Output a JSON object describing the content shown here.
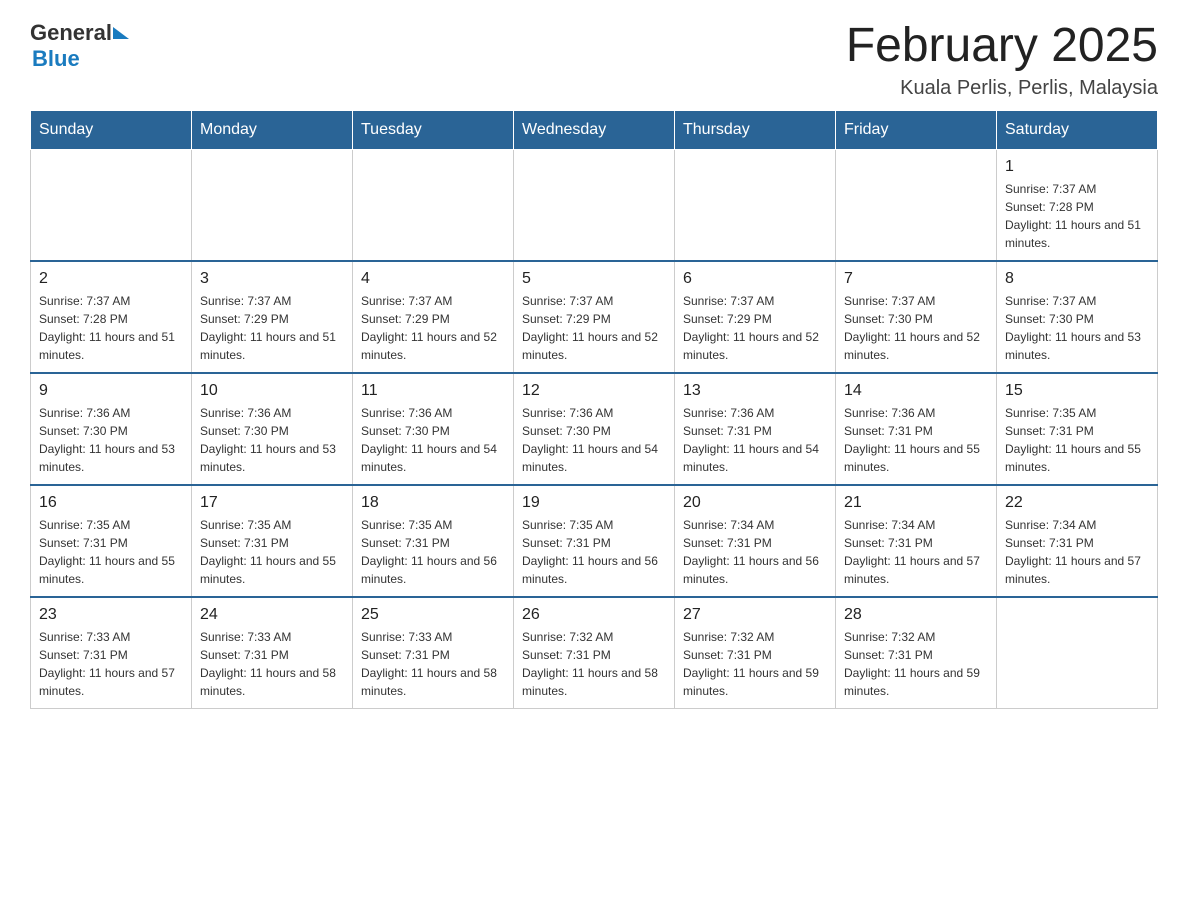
{
  "header": {
    "logo": {
      "general": "General",
      "blue": "Blue"
    },
    "title": "February 2025",
    "location": "Kuala Perlis, Perlis, Malaysia"
  },
  "days_of_week": [
    "Sunday",
    "Monday",
    "Tuesday",
    "Wednesday",
    "Thursday",
    "Friday",
    "Saturday"
  ],
  "weeks": [
    {
      "days": [
        {
          "date": "",
          "info": ""
        },
        {
          "date": "",
          "info": ""
        },
        {
          "date": "",
          "info": ""
        },
        {
          "date": "",
          "info": ""
        },
        {
          "date": "",
          "info": ""
        },
        {
          "date": "",
          "info": ""
        },
        {
          "date": "1",
          "info": "Sunrise: 7:37 AM\nSunset: 7:28 PM\nDaylight: 11 hours and 51 minutes."
        }
      ]
    },
    {
      "days": [
        {
          "date": "2",
          "info": "Sunrise: 7:37 AM\nSunset: 7:28 PM\nDaylight: 11 hours and 51 minutes."
        },
        {
          "date": "3",
          "info": "Sunrise: 7:37 AM\nSunset: 7:29 PM\nDaylight: 11 hours and 51 minutes."
        },
        {
          "date": "4",
          "info": "Sunrise: 7:37 AM\nSunset: 7:29 PM\nDaylight: 11 hours and 52 minutes."
        },
        {
          "date": "5",
          "info": "Sunrise: 7:37 AM\nSunset: 7:29 PM\nDaylight: 11 hours and 52 minutes."
        },
        {
          "date": "6",
          "info": "Sunrise: 7:37 AM\nSunset: 7:29 PM\nDaylight: 11 hours and 52 minutes."
        },
        {
          "date": "7",
          "info": "Sunrise: 7:37 AM\nSunset: 7:30 PM\nDaylight: 11 hours and 52 minutes."
        },
        {
          "date": "8",
          "info": "Sunrise: 7:37 AM\nSunset: 7:30 PM\nDaylight: 11 hours and 53 minutes."
        }
      ]
    },
    {
      "days": [
        {
          "date": "9",
          "info": "Sunrise: 7:36 AM\nSunset: 7:30 PM\nDaylight: 11 hours and 53 minutes."
        },
        {
          "date": "10",
          "info": "Sunrise: 7:36 AM\nSunset: 7:30 PM\nDaylight: 11 hours and 53 minutes."
        },
        {
          "date": "11",
          "info": "Sunrise: 7:36 AM\nSunset: 7:30 PM\nDaylight: 11 hours and 54 minutes."
        },
        {
          "date": "12",
          "info": "Sunrise: 7:36 AM\nSunset: 7:30 PM\nDaylight: 11 hours and 54 minutes."
        },
        {
          "date": "13",
          "info": "Sunrise: 7:36 AM\nSunset: 7:31 PM\nDaylight: 11 hours and 54 minutes."
        },
        {
          "date": "14",
          "info": "Sunrise: 7:36 AM\nSunset: 7:31 PM\nDaylight: 11 hours and 55 minutes."
        },
        {
          "date": "15",
          "info": "Sunrise: 7:35 AM\nSunset: 7:31 PM\nDaylight: 11 hours and 55 minutes."
        }
      ]
    },
    {
      "days": [
        {
          "date": "16",
          "info": "Sunrise: 7:35 AM\nSunset: 7:31 PM\nDaylight: 11 hours and 55 minutes."
        },
        {
          "date": "17",
          "info": "Sunrise: 7:35 AM\nSunset: 7:31 PM\nDaylight: 11 hours and 55 minutes."
        },
        {
          "date": "18",
          "info": "Sunrise: 7:35 AM\nSunset: 7:31 PM\nDaylight: 11 hours and 56 minutes."
        },
        {
          "date": "19",
          "info": "Sunrise: 7:35 AM\nSunset: 7:31 PM\nDaylight: 11 hours and 56 minutes."
        },
        {
          "date": "20",
          "info": "Sunrise: 7:34 AM\nSunset: 7:31 PM\nDaylight: 11 hours and 56 minutes."
        },
        {
          "date": "21",
          "info": "Sunrise: 7:34 AM\nSunset: 7:31 PM\nDaylight: 11 hours and 57 minutes."
        },
        {
          "date": "22",
          "info": "Sunrise: 7:34 AM\nSunset: 7:31 PM\nDaylight: 11 hours and 57 minutes."
        }
      ]
    },
    {
      "days": [
        {
          "date": "23",
          "info": "Sunrise: 7:33 AM\nSunset: 7:31 PM\nDaylight: 11 hours and 57 minutes."
        },
        {
          "date": "24",
          "info": "Sunrise: 7:33 AM\nSunset: 7:31 PM\nDaylight: 11 hours and 58 minutes."
        },
        {
          "date": "25",
          "info": "Sunrise: 7:33 AM\nSunset: 7:31 PM\nDaylight: 11 hours and 58 minutes."
        },
        {
          "date": "26",
          "info": "Sunrise: 7:32 AM\nSunset: 7:31 PM\nDaylight: 11 hours and 58 minutes."
        },
        {
          "date": "27",
          "info": "Sunrise: 7:32 AM\nSunset: 7:31 PM\nDaylight: 11 hours and 59 minutes."
        },
        {
          "date": "28",
          "info": "Sunrise: 7:32 AM\nSunset: 7:31 PM\nDaylight: 11 hours and 59 minutes."
        },
        {
          "date": "",
          "info": ""
        }
      ]
    }
  ]
}
